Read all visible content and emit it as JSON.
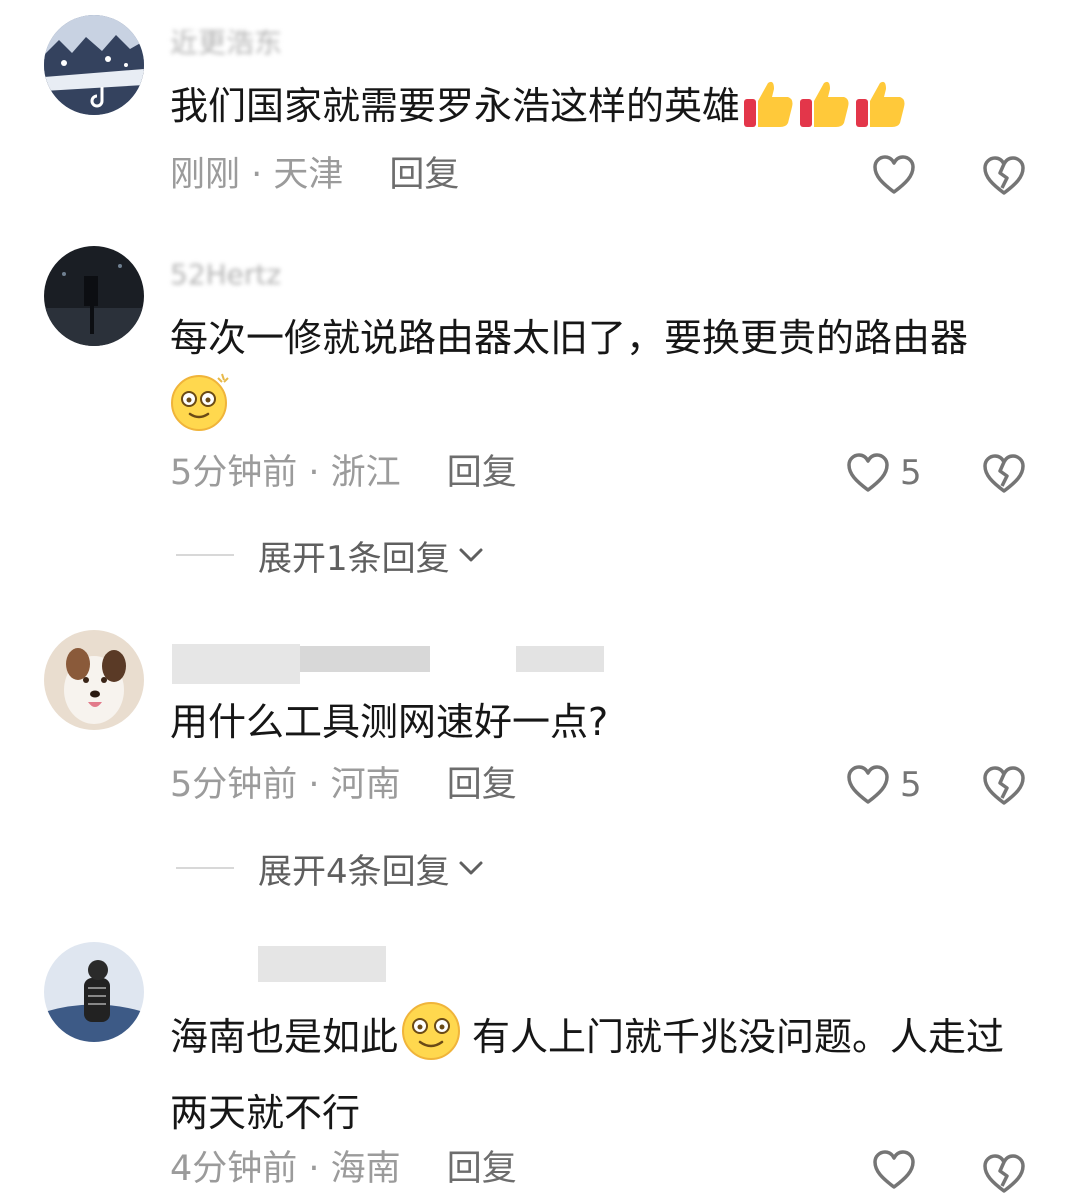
{
  "comments": [
    {
      "username": "近更浩东",
      "text_parts": [
        "我们国家就需要罗永浩这样的英雄"
      ],
      "emojis": [
        "thumbs-up-icon",
        "thumbs-up-icon",
        "thumbs-up-icon"
      ],
      "time": "刚刚",
      "location": "天津",
      "reply_label": "回复",
      "likes": ""
    },
    {
      "username": "52Hertz",
      "text_parts": [
        "每次一修就说路由器太旧了，要换更贵的路由器"
      ],
      "emojis": [
        "dazed-face-icon"
      ],
      "time": "5分钟前",
      "location": "浙江",
      "reply_label": "回复",
      "likes": "5",
      "expand_label": "展开1条回复"
    },
    {
      "username": "",
      "text_parts": [
        "用什么工具测网速好一点?"
      ],
      "emojis": [],
      "time": "5分钟前",
      "location": "河南",
      "reply_label": "回复",
      "likes": "5",
      "expand_label": "展开4条回复"
    },
    {
      "username": "",
      "text_parts": [
        "海南也是如此",
        "有人上门就千兆没问题。人走过两天就不行"
      ],
      "emojis": [
        "smiling-face-icon"
      ],
      "time": "4分钟前",
      "location": "海南",
      "reply_label": "回复",
      "likes": ""
    }
  ],
  "separator": " · ",
  "colors": {
    "text": "#161616",
    "meta": "#9b9b9b",
    "reply": "#6d6d6d",
    "icon": "#757575"
  },
  "icons": [
    "heart-outline-icon",
    "broken-heart-icon",
    "chevron-down-icon",
    "douyin-logo-icon"
  ]
}
